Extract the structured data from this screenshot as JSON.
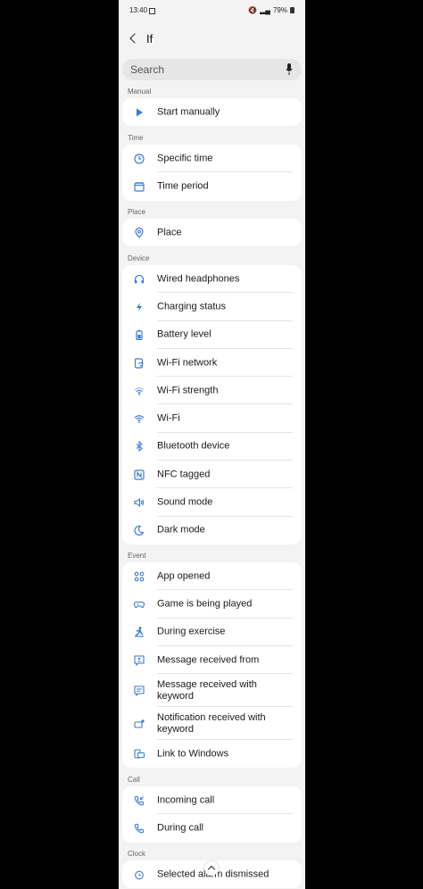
{
  "status": {
    "time": "13:40",
    "battery": "79%"
  },
  "header": {
    "title": "If"
  },
  "search": {
    "placeholder": "Search"
  },
  "accent": "#3a7bd5",
  "sections": {
    "manual": {
      "label": "Manual",
      "items": [
        {
          "label": "Start manually",
          "icon": "play-icon"
        }
      ]
    },
    "time": {
      "label": "Time",
      "items": [
        {
          "label": "Specific time",
          "icon": "clock-icon"
        },
        {
          "label": "Time period",
          "icon": "calendar-icon"
        }
      ]
    },
    "place": {
      "label": "Place",
      "items": [
        {
          "label": "Place",
          "icon": "location-pin-icon"
        }
      ]
    },
    "device": {
      "label": "Device",
      "items": [
        {
          "label": "Wired headphones",
          "icon": "headphones-icon"
        },
        {
          "label": "Charging status",
          "icon": "lightning-icon"
        },
        {
          "label": "Battery level",
          "icon": "battery-icon"
        },
        {
          "label": "Wi-Fi network",
          "icon": "wifi-network-icon"
        },
        {
          "label": "Wi-Fi strength",
          "icon": "wifi-strength-icon"
        },
        {
          "label": "Wi-Fi",
          "icon": "wifi-icon"
        },
        {
          "label": "Bluetooth device",
          "icon": "bluetooth-icon"
        },
        {
          "label": "NFC tagged",
          "icon": "nfc-icon"
        },
        {
          "label": "Sound mode",
          "icon": "speaker-icon"
        },
        {
          "label": "Dark mode",
          "icon": "moon-icon"
        }
      ]
    },
    "event": {
      "label": "Event",
      "items": [
        {
          "label": "App opened",
          "icon": "apps-icon"
        },
        {
          "label": "Game is being played",
          "icon": "gamepad-icon"
        },
        {
          "label": "During exercise",
          "icon": "exercise-icon"
        },
        {
          "label": "Message received from",
          "icon": "message-person-icon"
        },
        {
          "label": "Message received with keyword",
          "icon": "message-keyword-icon"
        },
        {
          "label": "Notification received with keyword",
          "icon": "notification-icon"
        },
        {
          "label": "Link to Windows",
          "icon": "link-windows-icon"
        }
      ]
    },
    "call": {
      "label": "Call",
      "items": [
        {
          "label": "Incoming call",
          "icon": "incoming-call-icon"
        },
        {
          "label": "During call",
          "icon": "phone-icon"
        }
      ]
    },
    "clock": {
      "label": "Clock",
      "items": [
        {
          "label": "Selected alarm dismissed",
          "icon": "alarm-icon"
        }
      ]
    }
  }
}
